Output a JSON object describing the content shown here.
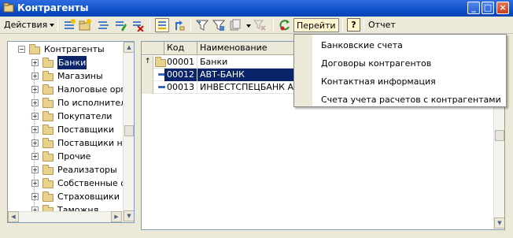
{
  "window": {
    "title": "Контрагенты"
  },
  "toolbar": {
    "actions_label": "Действия",
    "goto_label": "Перейти",
    "help_label": "?",
    "report_label": "Отчет"
  },
  "tree": {
    "root": "Контрагенты",
    "items": [
      {
        "label": "Банки",
        "selected": true
      },
      {
        "label": "Магазины"
      },
      {
        "label": "Налоговые орга"
      },
      {
        "label": "По исполнитель"
      },
      {
        "label": "Покупатели"
      },
      {
        "label": "Поставщики"
      },
      {
        "label": "Поставщики на"
      },
      {
        "label": "Прочие"
      },
      {
        "label": "Реализаторы"
      },
      {
        "label": "Собственные ор"
      },
      {
        "label": "Страховщики"
      },
      {
        "label": "Таможня"
      }
    ]
  },
  "grid": {
    "columns": [
      "Код",
      "Наименование"
    ],
    "rows": [
      {
        "code": "00001",
        "name": "Банки",
        "type": "folder"
      },
      {
        "code": "00012",
        "name": "АВТ-БАНК",
        "type": "item",
        "selected": true
      },
      {
        "code": "00013",
        "name": "ИНВЕСТСПЕЦБАНК АК",
        "type": "item"
      }
    ]
  },
  "goto_menu": {
    "items": [
      "Банковские счета",
      "Договоры контрагентов",
      "Контактная информация",
      "Счета учета расчетов с контрагентами"
    ]
  },
  "colors": {
    "titlebar": "#0a43b3",
    "selection": "#0a246a",
    "folder": "#e8d28c"
  }
}
